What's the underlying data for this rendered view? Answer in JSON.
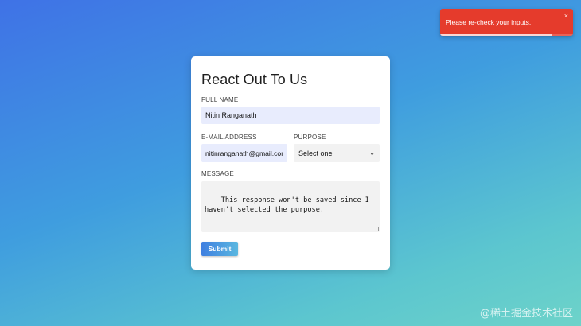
{
  "form": {
    "title": "React Out To Us",
    "full_name_label": "FULL NAME",
    "full_name_value": "Nitin Ranganath",
    "email_label": "E-MAIL ADDRESS",
    "email_value": "nitinranganath@gmail.com",
    "purpose_label": "PURPOSE",
    "purpose_selected": "Select one",
    "message_label": "MESSAGE",
    "message_value": "This response won't be saved since I haven't selected the purpose.",
    "submit_label": "Submit"
  },
  "toast": {
    "message": "Please re-check your inputs.",
    "close_glyph": "×",
    "progress": 0.84
  },
  "watermark": {
    "text": "@稀土掘金技术社区"
  },
  "colors": {
    "toast_bg": "#e53b2c",
    "accent": "#3f7fe0",
    "filled_input_bg": "#e8ecfd"
  }
}
